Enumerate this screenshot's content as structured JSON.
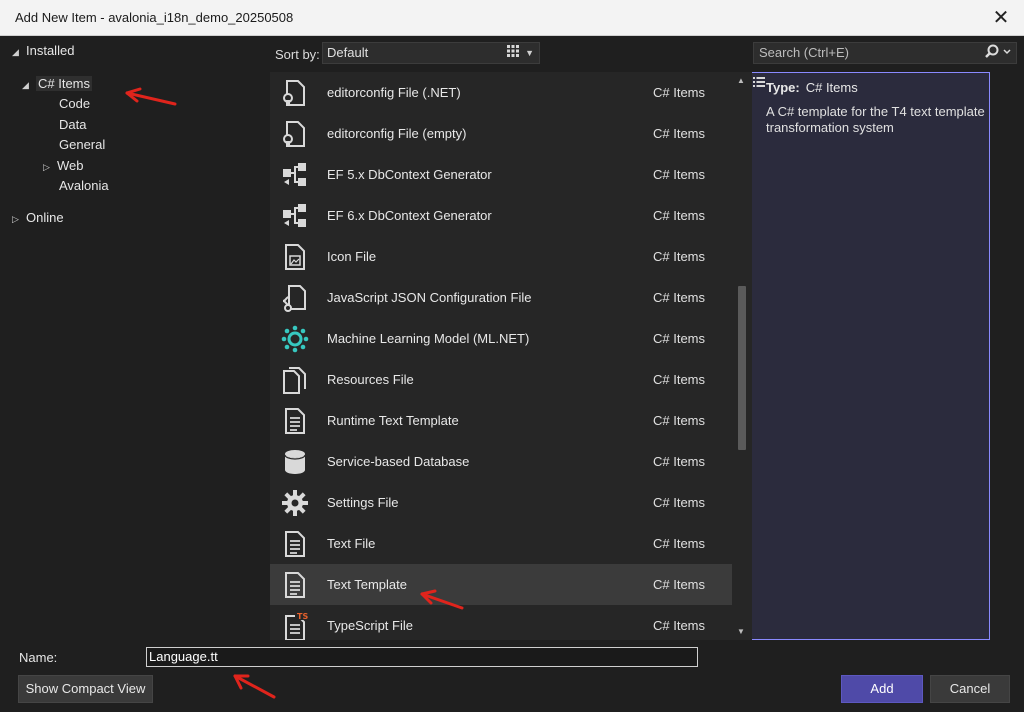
{
  "window": {
    "title": "Add New Item - avalonia_i18n_demo_20250508",
    "close_glyph": "✕"
  },
  "tree": {
    "installed": "Installed",
    "csharp_items": "C# Items",
    "children": [
      "Code",
      "Data",
      "General",
      "Web",
      "Avalonia"
    ],
    "online": "Online"
  },
  "sort": {
    "label": "Sort by:",
    "value": "Default"
  },
  "search": {
    "placeholder": "Search (Ctrl+E)"
  },
  "items": [
    {
      "name": "editorconfig File (.NET)",
      "category": "C# Items",
      "icon": "editorconfig-icon"
    },
    {
      "name": "editorconfig File (empty)",
      "category": "C# Items",
      "icon": "editorconfig-icon"
    },
    {
      "name": "EF 5.x DbContext Generator",
      "category": "C# Items",
      "icon": "ef-generator-icon"
    },
    {
      "name": "EF 6.x DbContext Generator",
      "category": "C# Items",
      "icon": "ef-generator-icon"
    },
    {
      "name": "Icon File",
      "category": "C# Items",
      "icon": "icon-file-icon"
    },
    {
      "name": "JavaScript JSON Configuration File",
      "category": "C# Items",
      "icon": "json-config-icon"
    },
    {
      "name": "Machine Learning Model (ML.NET)",
      "category": "C# Items",
      "icon": "ml-model-icon"
    },
    {
      "name": "Resources File",
      "category": "C# Items",
      "icon": "resources-file-icon"
    },
    {
      "name": "Runtime Text Template",
      "category": "C# Items",
      "icon": "text-document-icon"
    },
    {
      "name": "Service-based Database",
      "category": "C# Items",
      "icon": "database-icon"
    },
    {
      "name": "Settings File",
      "category": "C# Items",
      "icon": "gear-icon"
    },
    {
      "name": "Text File",
      "category": "C# Items",
      "icon": "text-document-icon"
    },
    {
      "name": "Text Template",
      "category": "C# Items",
      "icon": "text-document-icon",
      "selected": true
    },
    {
      "name": "TypeScript File",
      "category": "C# Items",
      "icon": "typescript-file-icon"
    }
  ],
  "details": {
    "type_label": "Type:",
    "type_value": "C# Items",
    "description": "A C# template for the T4 text template transformation system"
  },
  "bottom": {
    "name_label": "Name:",
    "name_value": "Language.tt",
    "compact_view": "Show Compact View",
    "add": "Add",
    "cancel": "Cancel"
  },
  "colors": {
    "accent": "#4f4aa8",
    "annotation": "#e0241c",
    "selection": "#3b3b3b"
  }
}
